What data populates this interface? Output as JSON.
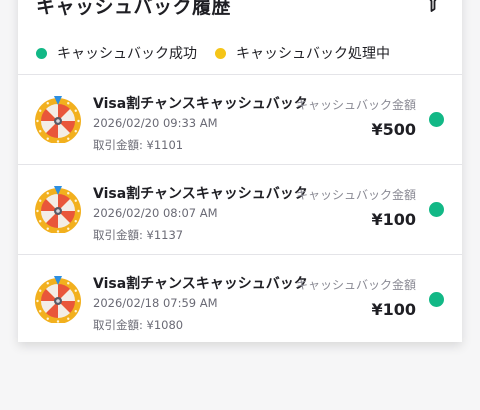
{
  "page": {
    "title": "キャッシュバック履歴",
    "filter_icon": "filter-icon"
  },
  "legend": [
    {
      "label": "キャッシュバック成功",
      "color": "#12b886"
    },
    {
      "label": "キャッシュバック処理中",
      "color": "#f5c518"
    }
  ],
  "colors": {
    "success": "#12b886",
    "pending": "#f5c518",
    "wheel_rim": "#f2b01e",
    "wheel_segment_red": "#e9563a",
    "wheel_segment_light": "#f3ede6",
    "pointer": "#2d8fe0"
  },
  "transactions": [
    {
      "title": "Visa割チャンスキャッシュバック",
      "date": "2026/02/20 09:33 AM",
      "txn_amount": "取引金額: ¥1101",
      "amount_label": "キャッシュバック金額",
      "amount": "¥500",
      "status": "success",
      "icon": "prize-wheel-icon"
    },
    {
      "title": "Visa割チャンスキャッシュバック",
      "date": "2026/02/20 08:07 AM",
      "txn_amount": "取引金額: ¥1137",
      "amount_label": "キャッシュバック金額",
      "amount": "¥100",
      "status": "success",
      "icon": "prize-wheel-icon"
    },
    {
      "title": "Visa割チャンスキャッシュバック",
      "date": "2026/02/18 07:59 AM",
      "txn_amount": "取引金額: ¥1080",
      "amount_label": "キャッシュバック金額",
      "amount": "¥100",
      "status": "success",
      "icon": "prize-wheel-icon"
    }
  ]
}
